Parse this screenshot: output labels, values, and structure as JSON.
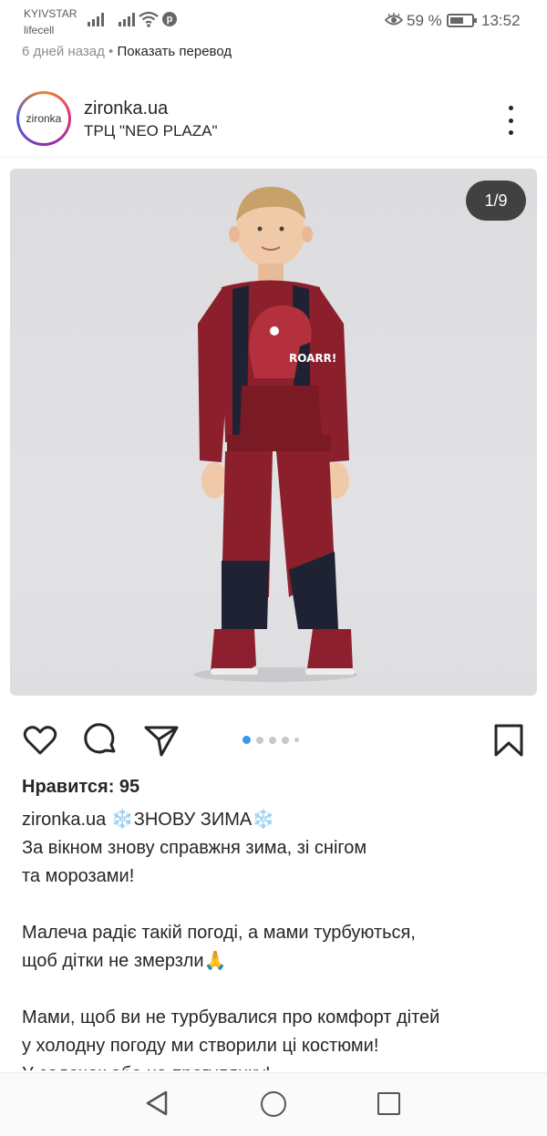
{
  "status_bar": {
    "carrier_1": "KYIVSTAR",
    "carrier_2": "lifecell",
    "battery": "59 %",
    "time": "13:52"
  },
  "notification": {
    "age": "6 дней назад",
    "separator": " • ",
    "action": "Показать перевод"
  },
  "post": {
    "avatar_text": "zironka",
    "username": "zironka.ua",
    "location": "ТРЦ \"NEO PLAZA\"",
    "image_counter": "1/9",
    "likes": "Нравится: 95",
    "caption": {
      "username": "zironka.ua",
      "snow_emoji": "❄️",
      "title": "ЗНОВУ ЗИМА",
      "line_1": "За вікном знову справжня зима, зі снігом",
      "line_2": "та морозами!",
      "line_3": "Малеча радіє такій погоді, а мами турбуються,",
      "line_4": "щоб дітки не змерзли🙏",
      "line_5": "Мами, щоб ви не турбувалися про комфорт дітей",
      "line_6": "у холодну погоду ми створили ці костюми!",
      "line_7": "У садочок або на прогулянку!"
    }
  },
  "icons": {
    "like": "heart-icon",
    "comment": "comment-icon",
    "share": "send-icon",
    "save": "bookmark-icon",
    "more": "more-vertical-icon"
  },
  "colors": {
    "accent": "#3897f0",
    "text": "#262626",
    "muted": "#8e8e8e",
    "sweatshirt": "#8b1f2b"
  }
}
